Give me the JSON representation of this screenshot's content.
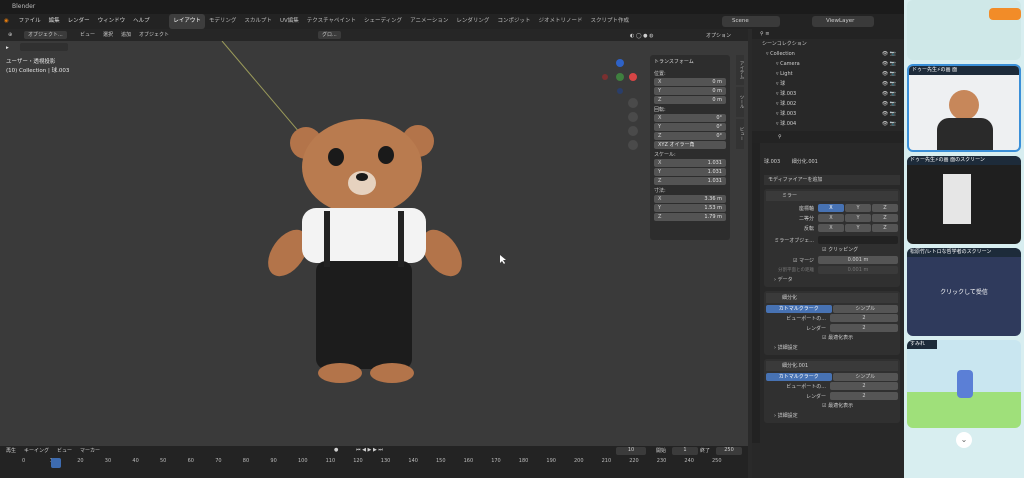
{
  "app": {
    "title": "Blender"
  },
  "menu": [
    "ファイル",
    "編集",
    "レンダー",
    "ウィンドウ",
    "ヘルプ"
  ],
  "workspaces": [
    "レイアウト",
    "モデリング",
    "スカルプト",
    "UV編集",
    "テクスチャペイント",
    "シェーディング",
    "アニメーション",
    "レンダリング",
    "コンポジット",
    "ジオメトリノード",
    "スクリプト作成"
  ],
  "scene": {
    "label": "Scene",
    "view_layer": "ViewLayer"
  },
  "viewport_header": {
    "mode": "オブジェクト...",
    "items": [
      "ビュー",
      "選択",
      "追加",
      "オブジェクト"
    ],
    "orientation": "グロ...",
    "options": "オプション"
  },
  "viewport": {
    "view_name": "ユーザー・透視投影",
    "collection_info": "(10) Collection | 球.003"
  },
  "npanel": {
    "title": "トランスフォーム",
    "location_label": "位置:",
    "location": [
      {
        "axis": "X",
        "value": "0 m"
      },
      {
        "axis": "Y",
        "value": "0 m"
      },
      {
        "axis": "Z",
        "value": "0 m"
      }
    ],
    "rotation_label": "回転:",
    "rotation": [
      {
        "axis": "X",
        "value": "0°"
      },
      {
        "axis": "Y",
        "value": "0°"
      },
      {
        "axis": "Z",
        "value": "0°"
      }
    ],
    "rotation_mode": "XYZ オイラー角",
    "scale_label": "スケール:",
    "scale": [
      {
        "axis": "X",
        "value": "1.031"
      },
      {
        "axis": "Y",
        "value": "1.031"
      },
      {
        "axis": "Z",
        "value": "1.031"
      }
    ],
    "dimensions_label": "寸法:",
    "dimensions": [
      {
        "axis": "X",
        "value": "3.36 m"
      },
      {
        "axis": "Y",
        "value": "1.53 m"
      },
      {
        "axis": "Z",
        "value": "1.79 m"
      }
    ],
    "tabs": [
      "アイテム",
      "ツール",
      "ビュー"
    ]
  },
  "outliner": {
    "title": "シーンコレクション",
    "items": [
      {
        "name": "Collection",
        "indent": 0
      },
      {
        "name": "Camera",
        "indent": 1
      },
      {
        "name": "Light",
        "indent": 1
      },
      {
        "name": "球",
        "indent": 1
      },
      {
        "name": "球.003",
        "indent": 1
      },
      {
        "name": "球.002",
        "indent": 1
      },
      {
        "name": "球.003",
        "indent": 1
      },
      {
        "name": "球.004",
        "indent": 1
      }
    ]
  },
  "properties": {
    "object": "球.003",
    "modifier_name": "細分化.001",
    "add_modifier": "モディファイアーを追加",
    "mirror": {
      "name": "ミラー",
      "axis_label": "座標軸",
      "bisect_label": "二等分",
      "flip_label": "反転",
      "axes": [
        "X",
        "Y",
        "Z"
      ],
      "mirror_object_label": "ミラーオブジェ...",
      "clipping_label": "クリッピング",
      "merge_label": "マージ",
      "merge_value": "0.001 m",
      "bisect_dist_label": "分割平面との距離",
      "bisect_dist_value": "0.001 m",
      "data_label": "データ"
    },
    "subsurf1": {
      "name": "細分化",
      "tab_cc": "カトマルクラーク",
      "tab_simple": "シンプル",
      "viewport_label": "ビューポートの...",
      "viewport_value": "2",
      "render_label": "レンダー",
      "render_value": "2",
      "optimal_label": "最適化表示",
      "advanced_label": "詳細設定"
    },
    "subsurf2": {
      "name": "細分化.001",
      "tab_cc": "カトマルクラーク",
      "tab_simple": "シンプル",
      "viewport_label": "ビューポートの...",
      "viewport_value": "2",
      "render_label": "レンダー",
      "render_value": "2",
      "optimal_label": "最適化表示",
      "advanced_label": "詳細設定"
    }
  },
  "timeline": {
    "items": [
      "再生",
      "キーイング",
      "ビュー",
      "マーカー"
    ],
    "current_frame": "10",
    "start_label": "開始",
    "start": "1",
    "end_label": "終了",
    "end": "250",
    "ticks": [
      "0",
      "10",
      "20",
      "30",
      "40",
      "50",
      "60",
      "70",
      "80",
      "90",
      "100",
      "110",
      "120",
      "130",
      "140",
      "150",
      "160",
      "170",
      "180",
      "190",
      "200",
      "210",
      "220",
      "230",
      "240",
      "250"
    ]
  },
  "sidebar": {
    "tile1_label": "ドゥー先生⚡の画 面",
    "tile2_label": "ドゥー先生⚡の画 面のスクリーン",
    "tile3_label": "松原竹/レトロな哲学者のスクリーン",
    "tile3_button": "クリックして受信",
    "tile4_label": "すみれ"
  }
}
